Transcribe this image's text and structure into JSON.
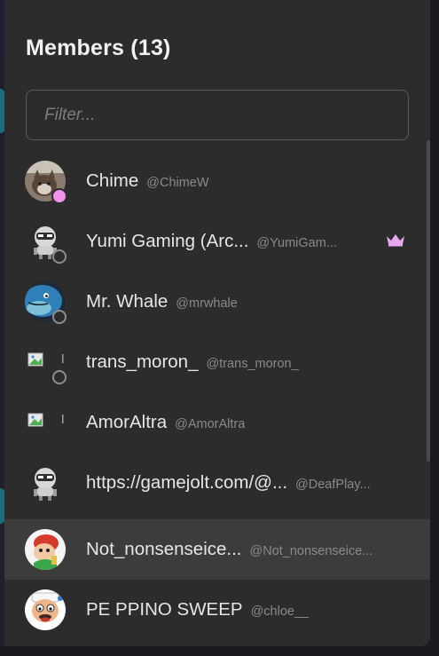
{
  "panel": {
    "title": "Members (13)",
    "filter_placeholder": "Filter..."
  },
  "members": [
    {
      "name": "Chime",
      "handle": "@ChimeW",
      "status": "online",
      "avatar": "cat-photo"
    },
    {
      "name": "Yumi Gaming (Arc...",
      "handle": "@YumiGam...",
      "status": "offline",
      "avatar": "default-robot",
      "badge": "crown-icon"
    },
    {
      "name": "Mr. Whale",
      "handle": "@mrwhale",
      "status": "offline",
      "avatar": "whale-drawing"
    },
    {
      "name": "trans_moron_",
      "handle": "@trans_moron_",
      "status": "offline",
      "avatar": "broken-image"
    },
    {
      "name": "AmorAltra",
      "handle": "@AmorAltra",
      "status": "none",
      "avatar": "broken-image"
    },
    {
      "name": "https://gamejolt.com/@...",
      "handle": "@DeafPlay...",
      "status": "none",
      "avatar": "default-robot"
    },
    {
      "name": "Not_nonsenseice...",
      "handle": "@Not_nonsenseice...",
      "status": "none",
      "avatar": "cartoon-character",
      "highlighted": true
    },
    {
      "name": "PE PPINO SWEEP",
      "handle": "@chloe__",
      "status": "none",
      "avatar": "peppino-face"
    }
  ],
  "colors": {
    "panel_bg": "#2c2c2c",
    "highlight_bg": "#3c3c3c",
    "online": "#f193e9",
    "crown": "#e7a8f0"
  }
}
